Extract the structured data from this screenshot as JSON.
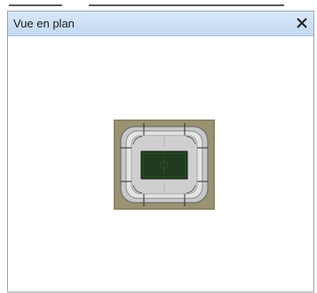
{
  "window": {
    "title": "Vue en plan",
    "close_label": "×"
  },
  "view": {
    "content_type": "stadium-plan",
    "icon": "stadium-plan-image"
  },
  "colors": {
    "titlebar": "#c9dcf2",
    "border": "#9aa3ad",
    "pitch": "#1f3a1c",
    "stands": "#d6d6d6",
    "ground": "#8c8566"
  }
}
